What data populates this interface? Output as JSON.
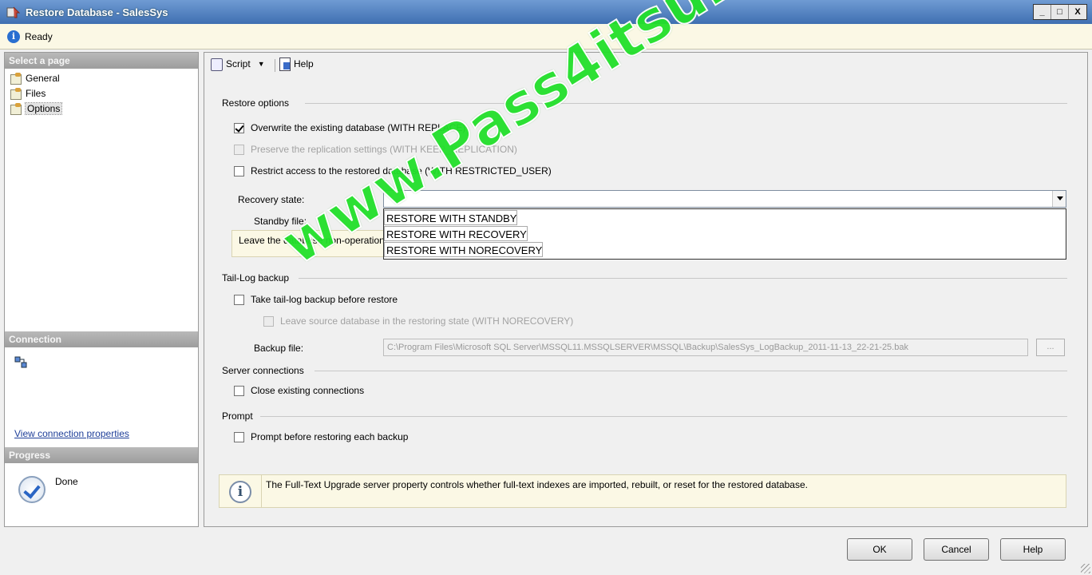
{
  "window": {
    "title": "Restore Database - SalesSys",
    "controls": [
      "_",
      "□",
      "X"
    ]
  },
  "status": {
    "text": "Ready",
    "icon": "info-icon"
  },
  "left": {
    "select_page_header": "Select a page",
    "pages": [
      {
        "label": "General",
        "selected": false
      },
      {
        "label": "Files",
        "selected": false
      },
      {
        "label": "Options",
        "selected": true
      }
    ],
    "connection_header": "Connection",
    "view_connection_link": "View connection properties",
    "progress_header": "Progress",
    "progress_status": "Done"
  },
  "toolbar": {
    "script_label": "Script",
    "help_label": "Help"
  },
  "restore_options": {
    "section": "Restore options",
    "overwrite": {
      "label": "Overwrite the existing database (WITH REPLACE)",
      "checked": true
    },
    "preserve": {
      "label": "Preserve the replication settings (WITH KEEP_REPLICATION)",
      "checked": false,
      "disabled": true
    },
    "restrict": {
      "label": "Restrict access to the restored database (WITH RESTRICTED_USER)",
      "checked": false
    },
    "recovery_label": "Recovery state:",
    "recovery_value": "",
    "recovery_options": [
      "RESTORE WITH STANDBY",
      "RESTORE WITH RECOVERY",
      "RESTORE WITH NORECOVERY"
    ],
    "standby_label": "Standby file:",
    "hint": "Leave the database non-operational"
  },
  "tail_log": {
    "section": "Tail-Log backup",
    "take": {
      "label": "Take tail-log backup before restore",
      "checked": false
    },
    "leave": {
      "label": "Leave source database in the restoring state (WITH NORECOVERY)",
      "checked": false,
      "disabled": true
    },
    "backup_file_label": "Backup file:",
    "backup_file_value": "C:\\Program Files\\Microsoft SQL Server\\MSSQL11.MSSQLSERVER\\MSSQL\\Backup\\SalesSys_LogBackup_2011-11-13_22-21-25.bak",
    "browse_label": "..."
  },
  "server_connections": {
    "section": "Server connections",
    "close": {
      "label": "Close existing connections",
      "checked": false
    }
  },
  "prompt": {
    "section": "Prompt",
    "prompt_before": {
      "label": "Prompt before restoring each backup",
      "checked": false
    }
  },
  "info_text": "The Full-Text Upgrade server property controls whether full-text indexes are imported, rebuilt, or reset for the restored database.",
  "buttons": {
    "ok": "OK",
    "cancel": "Cancel",
    "help": "Help"
  },
  "watermark": "www.Pass4itsure.com"
}
